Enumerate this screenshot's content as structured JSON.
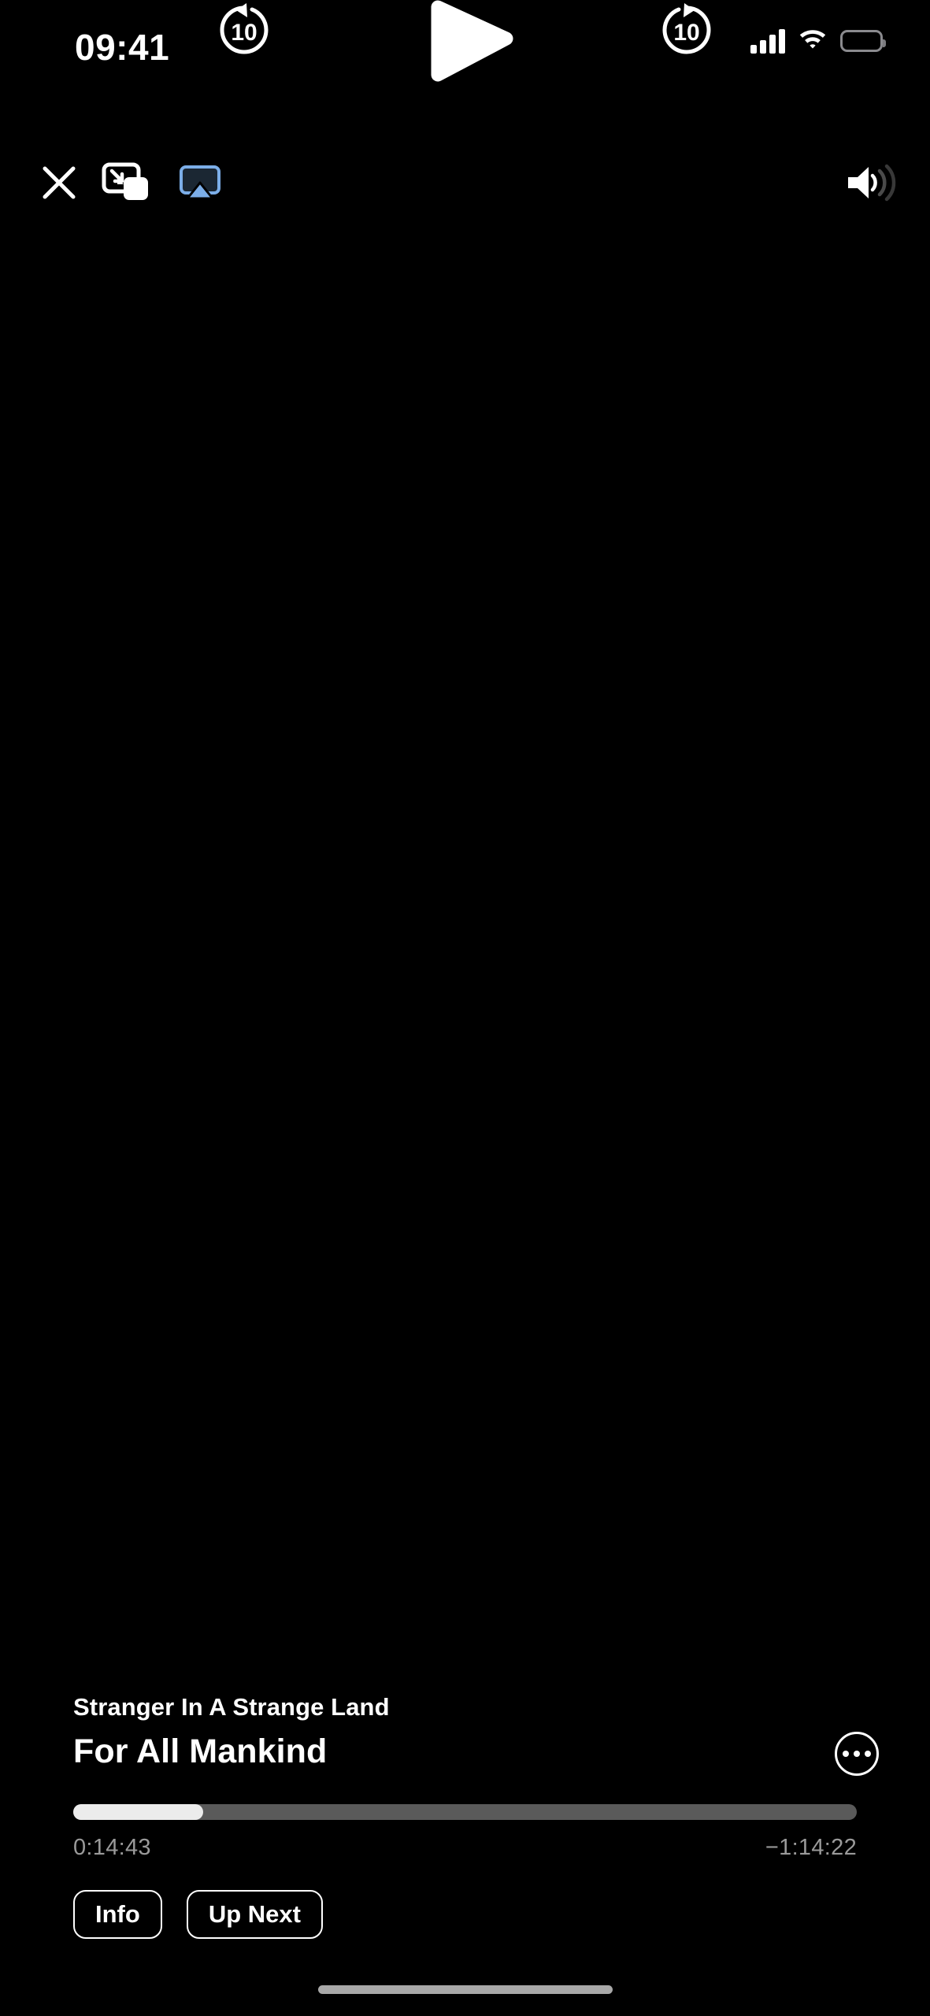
{
  "status_bar": {
    "time": "09:41",
    "cellular_icon": "signal-bars-icon",
    "wifi_icon": "wifi-icon",
    "battery_icon": "battery-icon"
  },
  "top_toolbar": {
    "close_icon": "close-icon",
    "pip_icon": "picture-in-picture-icon",
    "airplay_icon": "airplay-icon",
    "volume_icon": "volume-high-icon",
    "airplay_color": "#7caee8"
  },
  "player_controls": {
    "skip_back_icon": "skip-back-10-icon",
    "skip_back_label": "10",
    "play_icon": "play-icon",
    "skip_forward_icon": "skip-forward-10-icon",
    "skip_forward_label": "10"
  },
  "now_playing": {
    "subtitle": "Stranger In A Strange Land",
    "title": "For All Mankind",
    "more_icon": "more-ellipsis-icon"
  },
  "scrubber": {
    "progress_percent": 16.6,
    "elapsed": "0:14:43",
    "remaining": "−1:14:22",
    "fill_color": "#ececec",
    "track_color": "#5a5a5a"
  },
  "actions": {
    "info_label": "Info",
    "up_next_label": "Up Next"
  },
  "home_indicator": {
    "color": "#a8a8a8"
  }
}
